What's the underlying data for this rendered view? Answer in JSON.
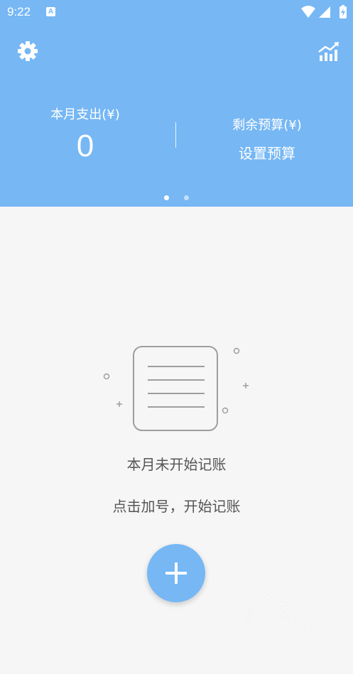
{
  "status_bar": {
    "time": "9:22",
    "notification_letter": "A"
  },
  "header": {
    "settings_icon": "gear-icon",
    "stats_icon": "chart-trend-icon",
    "monthly_expense_label": "本月支出(¥)",
    "monthly_expense_value": "0",
    "remaining_budget_label": "剩余预算(¥)",
    "set_budget_link": "设置预算",
    "page_count": 2,
    "active_page": 1
  },
  "empty_state": {
    "title": "本月未开始记账",
    "hint": "点击加号，开始记账",
    "icon": "document-list-icon"
  },
  "fab": {
    "icon": "plus-icon"
  },
  "watermark": "出色软件站",
  "colors": {
    "primary": "#76b7f4",
    "background": "#f6f6f6",
    "text_gray": "#555555"
  }
}
